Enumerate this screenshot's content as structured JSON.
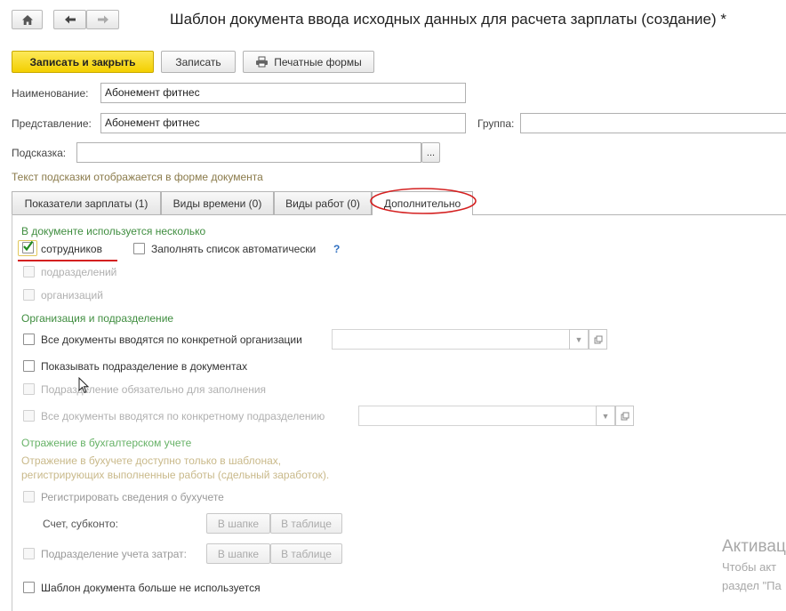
{
  "window": {
    "title": "Шаблон документа ввода исходных данных для расчета зарплаты (создание) *",
    "home_icon": "home-icon",
    "back_icon": "arrow-left-icon",
    "forward_icon": "arrow-right-icon"
  },
  "toolbar": {
    "save_close": "Записать и закрыть",
    "save": "Записать",
    "print_forms": "Печатные формы",
    "print_icon": "printer-icon"
  },
  "form": {
    "name_label": "Наименование:",
    "name_value": "Абонемент фитнес",
    "repr_label": "Представление:",
    "repr_value": "Абонемент фитнес",
    "group_label": "Группа:",
    "group_value": "",
    "hint_label": "Подсказка:",
    "hint_value": "",
    "hint_button": "...",
    "hint_note": "Текст подсказки отображается в форме документа"
  },
  "tabs": [
    {
      "label": "Показатели зарплаты (1)"
    },
    {
      "label": "Виды времени (0)"
    },
    {
      "label": "Виды работ (0)"
    },
    {
      "label": "Дополнительно"
    }
  ],
  "additional": {
    "multi_section": "В документе используется несколько",
    "employees": {
      "label": "сотрудников",
      "checked": true
    },
    "autofill": {
      "label": "Заполнять список автоматически",
      "checked": false,
      "help": "?"
    },
    "departments": {
      "label": "подразделений",
      "checked": false
    },
    "organizations": {
      "label": "организаций",
      "checked": false
    },
    "org_section": "Организация и подразделение",
    "org_specific": {
      "label": "Все документы вводятся по конкретной организации",
      "checked": false
    },
    "show_dept": {
      "label": "Показывать подразделение в документах",
      "checked": false
    },
    "dept_required": {
      "label": "Подразделение обязательно для заполнения",
      "checked": false
    },
    "dept_specific": {
      "label": "Все документы вводятся по конкретному подразделению",
      "checked": false
    },
    "acc_section": "Отражение в бухгалтерском учете",
    "acc_note_1": "Отражение в бухучете доступно только в шаблонах,",
    "acc_note_2": "регистрирующих выполненные работы (сдельный заработок).",
    "register_acc": {
      "label": "Регистрировать сведения о бухучете",
      "checked": false
    },
    "account_label": "Счет, субконто:",
    "in_header": "В шапке",
    "in_table": "В таблице",
    "cost_dept": {
      "label": "Подразделение учета затрат:",
      "checked": false
    },
    "template_unused": {
      "label": "Шаблон документа больше не используется",
      "checked": false
    }
  },
  "watermark": {
    "line1": "Активац",
    "line2": "Чтобы акт",
    "line3": "раздел \"Па"
  },
  "colors": {
    "primary_button": "#f5d200",
    "section_green": "#3f8d3f",
    "annotation_red": "#d42020"
  }
}
